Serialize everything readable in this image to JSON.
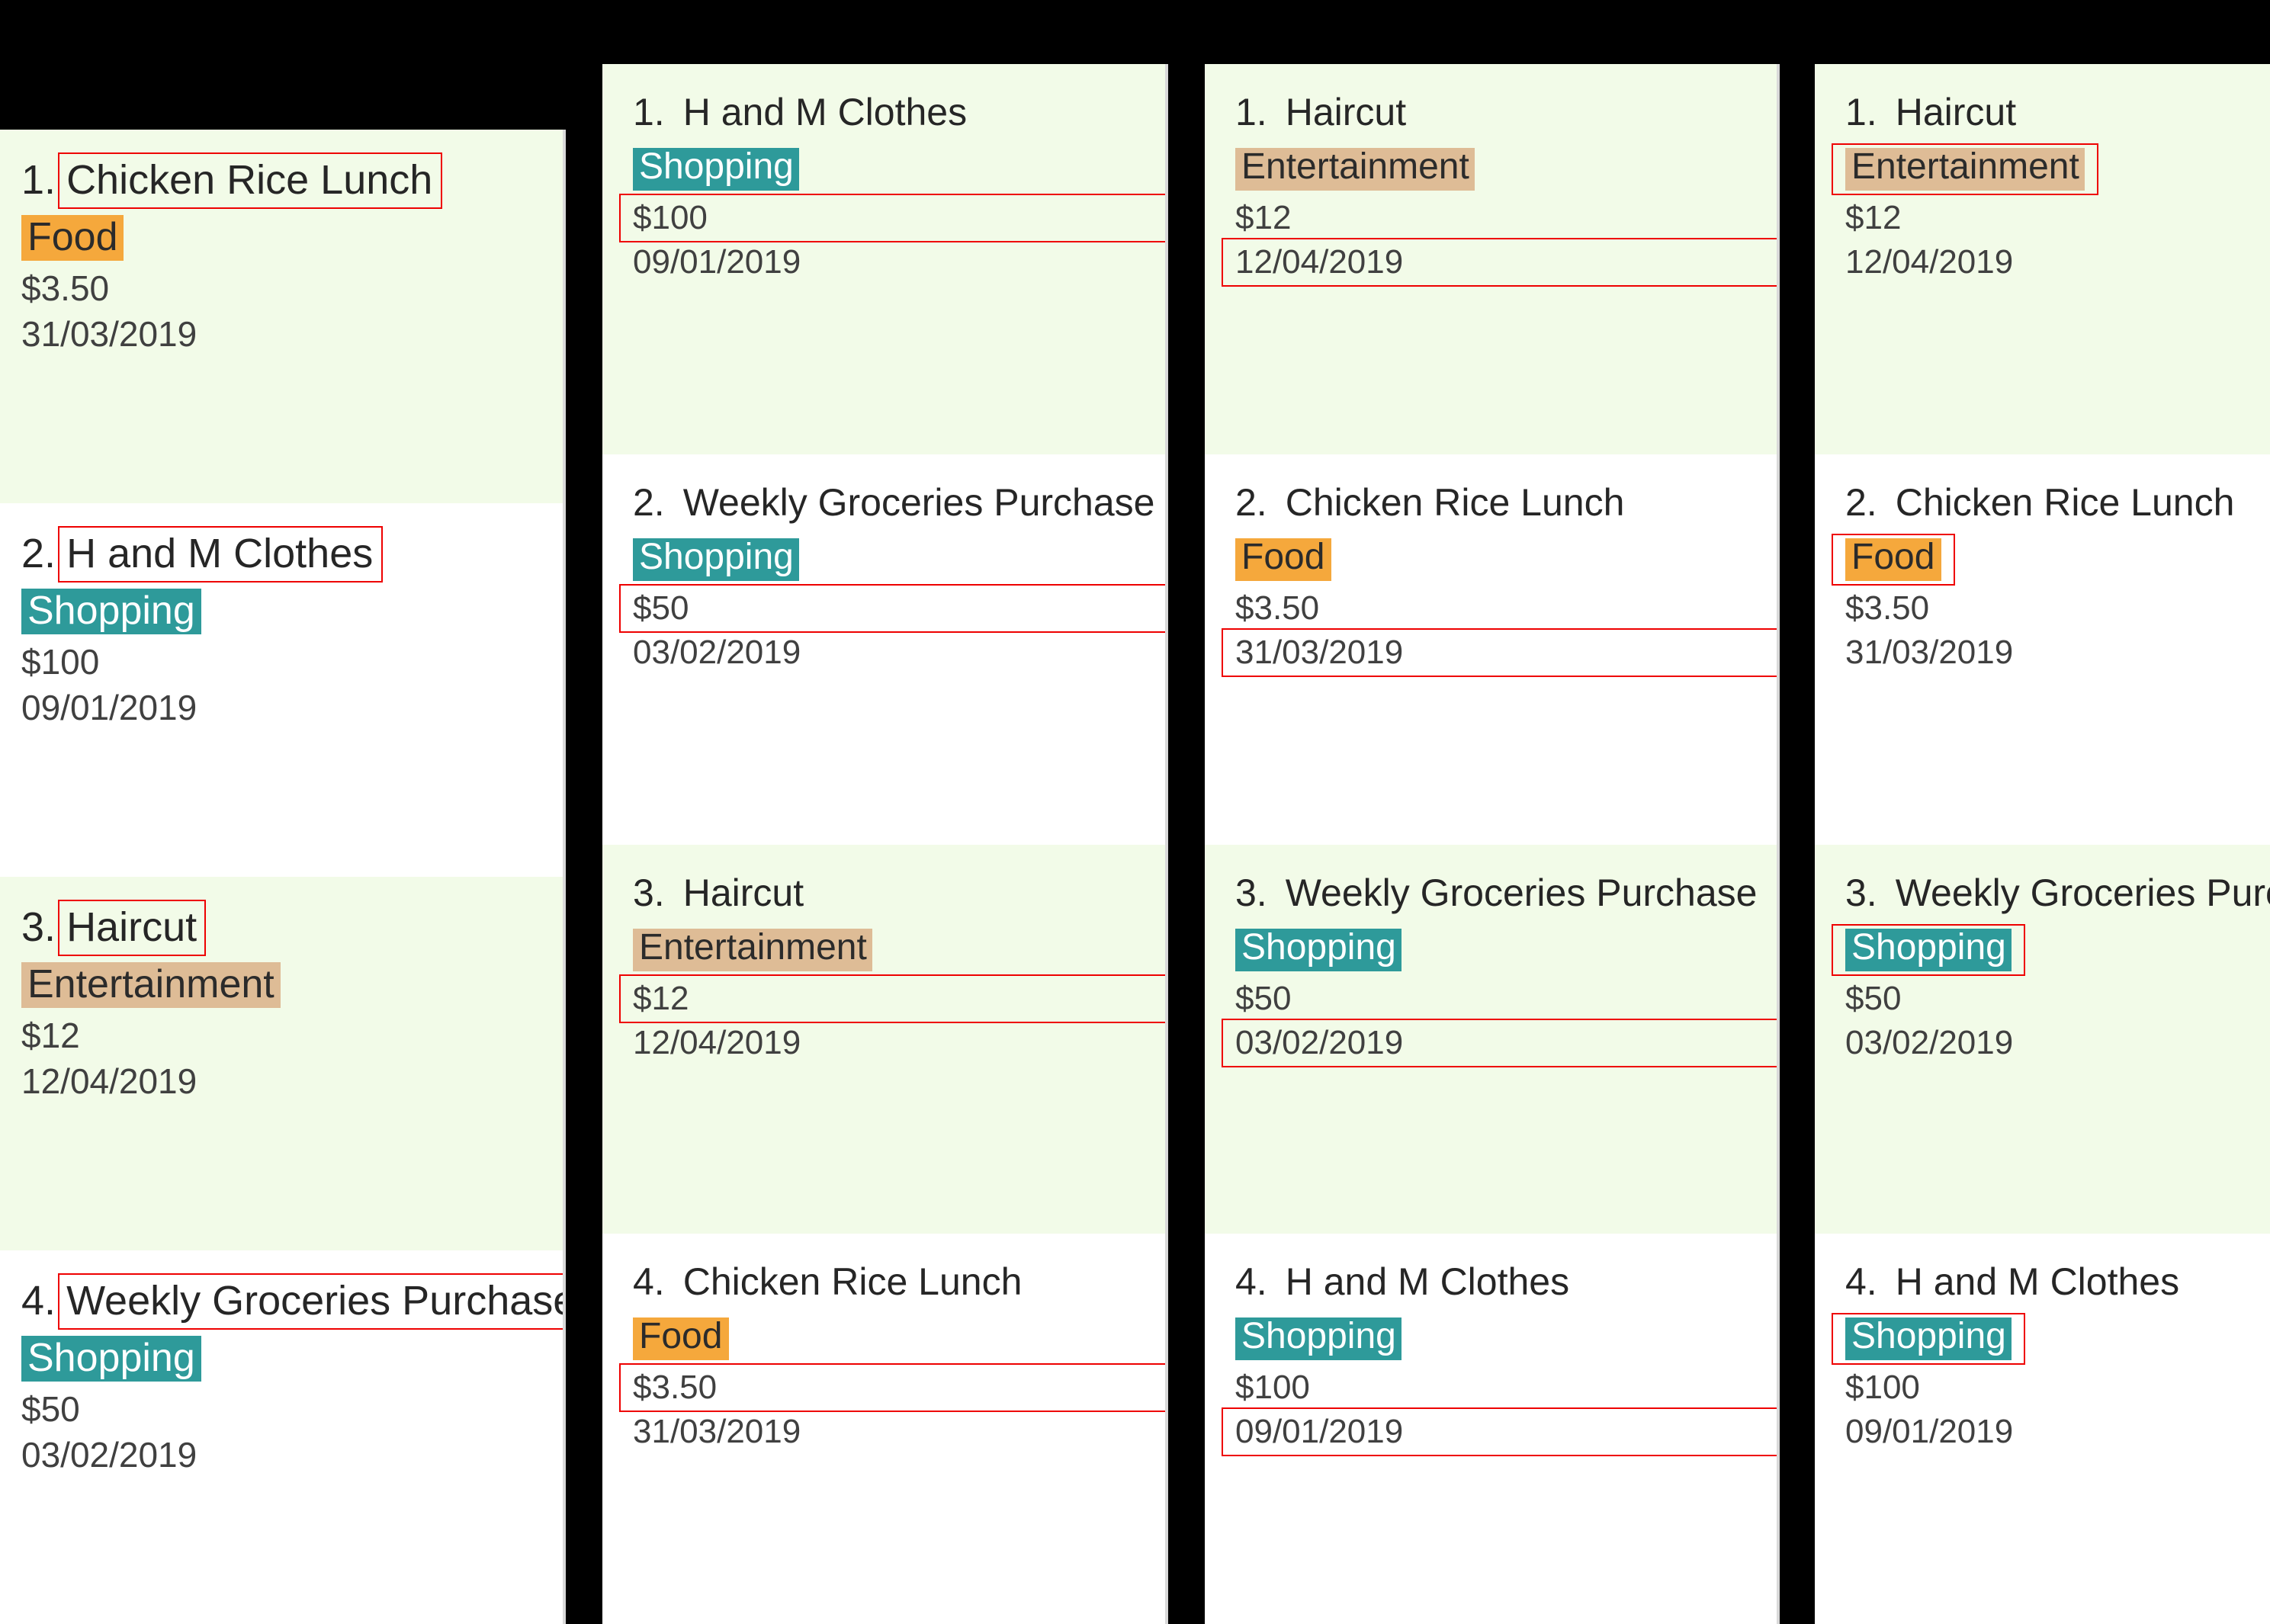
{
  "meta": {
    "background_color": "#000000",
    "row_alt_color": "#f2fbe8",
    "row_base_color": "#ffffff",
    "highlight_box_color": "#ee0000"
  },
  "categories": {
    "food": {
      "label": "Food",
      "bg": "#f5a83c",
      "fg": "#2b2b2b"
    },
    "shopping": {
      "label": "Shopping",
      "bg": "#2e9a9a",
      "fg": "#ffffff"
    },
    "entertainment": {
      "label": "Entertainment",
      "bg": "#debc96",
      "fg": "#2b2b2b"
    }
  },
  "panels": [
    {
      "id": "panel-1",
      "highlight_field": "title",
      "items": [
        {
          "num": "1.",
          "title": "Chicken Rice Lunch",
          "category": "Food",
          "amount": "$3.50",
          "date": "31/03/2019"
        },
        {
          "num": "2.",
          "title": "H and M Clothes",
          "category": "Shopping",
          "amount": "$100",
          "date": "09/01/2019"
        },
        {
          "num": "3.",
          "title": "Haircut",
          "category": "Entertainment",
          "amount": "$12",
          "date": "12/04/2019"
        },
        {
          "num": "4.",
          "title": "Weekly Groceries Purchase",
          "category": "Shopping",
          "amount": "$50",
          "date": "03/02/2019"
        }
      ]
    },
    {
      "id": "panel-2",
      "highlight_field": "amount",
      "items": [
        {
          "num": "1.",
          "title": "H and M Clothes",
          "category": "Shopping",
          "amount": "$100",
          "date": "09/01/2019"
        },
        {
          "num": "2.",
          "title": "Weekly Groceries Purchase",
          "category": "Shopping",
          "amount": "$50",
          "date": "03/02/2019"
        },
        {
          "num": "3.",
          "title": "Haircut",
          "category": "Entertainment",
          "amount": "$12",
          "date": "12/04/2019"
        },
        {
          "num": "4.",
          "title": "Chicken Rice Lunch",
          "category": "Food",
          "amount": "$3.50",
          "date": "31/03/2019"
        }
      ]
    },
    {
      "id": "panel-3",
      "highlight_field": "date",
      "items": [
        {
          "num": "1.",
          "title": "Haircut",
          "category": "Entertainment",
          "amount": "$12",
          "date": "12/04/2019"
        },
        {
          "num": "2.",
          "title": "Chicken Rice Lunch",
          "category": "Food",
          "amount": "$3.50",
          "date": "31/03/2019"
        },
        {
          "num": "3.",
          "title": "Weekly Groceries Purchase",
          "category": "Shopping",
          "amount": "$50",
          "date": "03/02/2019"
        },
        {
          "num": "4.",
          "title": "H and M Clothes",
          "category": "Shopping",
          "amount": "$100",
          "date": "09/01/2019"
        }
      ]
    },
    {
      "id": "panel-4",
      "highlight_field": "category",
      "items": [
        {
          "num": "1.",
          "title": "Haircut",
          "category": "Entertainment",
          "amount": "$12",
          "date": "12/04/2019"
        },
        {
          "num": "2.",
          "title": "Chicken Rice Lunch",
          "category": "Food",
          "amount": "$3.50",
          "date": "31/03/2019"
        },
        {
          "num": "3.",
          "title": "Weekly Groceries Purchase",
          "category": "Shopping",
          "amount": "$50",
          "date": "03/02/2019"
        },
        {
          "num": "4.",
          "title": "H and M Clothes",
          "category": "Shopping",
          "amount": "$100",
          "date": "09/01/2019"
        }
      ]
    }
  ]
}
